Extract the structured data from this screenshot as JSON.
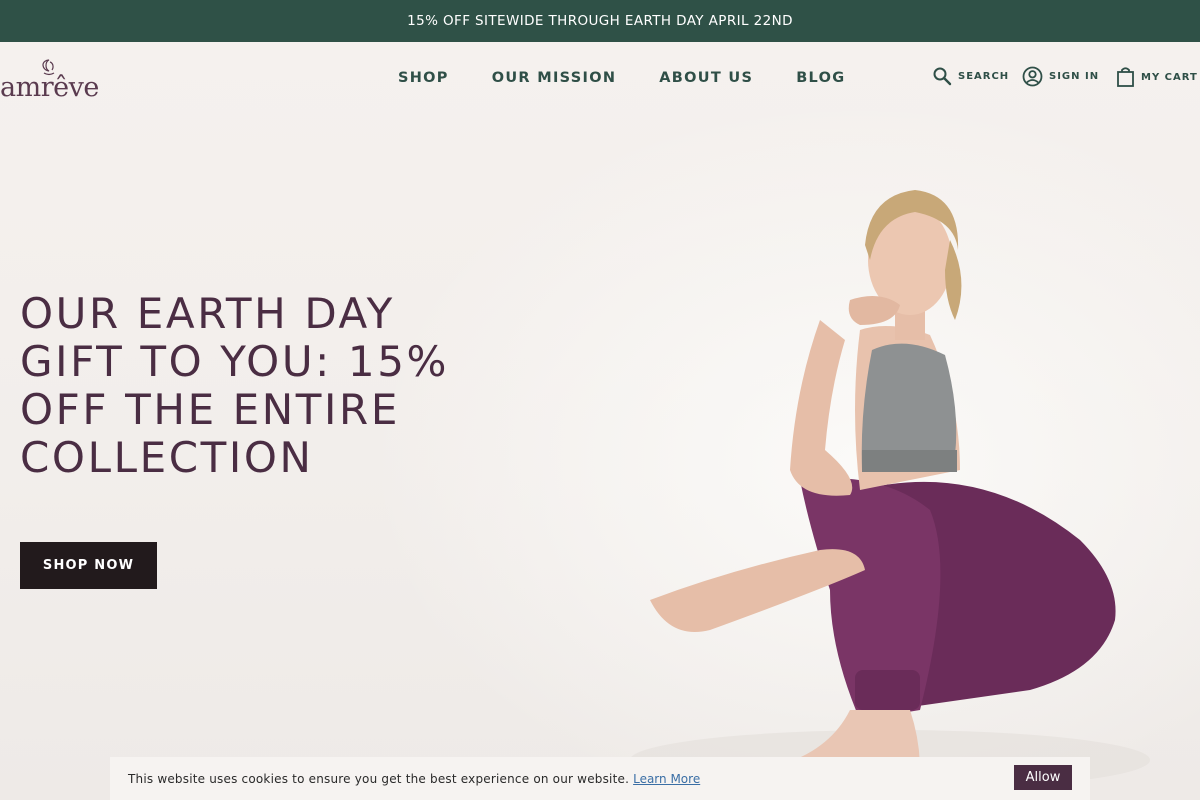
{
  "announcement": {
    "text": "15% OFF SITEWIDE THROUGH EARTH DAY APRIL 22ND"
  },
  "brand": {
    "name": "amrêve"
  },
  "nav": {
    "items": [
      {
        "label": "SHOP"
      },
      {
        "label": "OUR MISSION"
      },
      {
        "label": "ABOUT US"
      },
      {
        "label": "BLOG"
      }
    ]
  },
  "utility": {
    "search_label": "SEARCH",
    "signin_label": "SIGN IN",
    "cart_label": "MY CART"
  },
  "hero": {
    "headline": "OUR EARTH DAY GIFT TO YOU: 15% OFF THE ENTIRE COLLECTION",
    "cta_label": "SHOP NOW"
  },
  "cookie": {
    "message": "This website uses cookies to ensure you get the best experience on our website.",
    "learn_more": "Learn More",
    "allow_label": "Allow"
  },
  "colors": {
    "announcement_bg": "#2f5147",
    "headline": "#4a2d43",
    "cta_bg": "#221a1c",
    "allow_bg": "#4a2d43",
    "nav_text": "#2f4f47"
  },
  "icons": [
    "search-icon",
    "user-circle-icon",
    "shopping-bag-icon",
    "brand-crescent-icon"
  ]
}
